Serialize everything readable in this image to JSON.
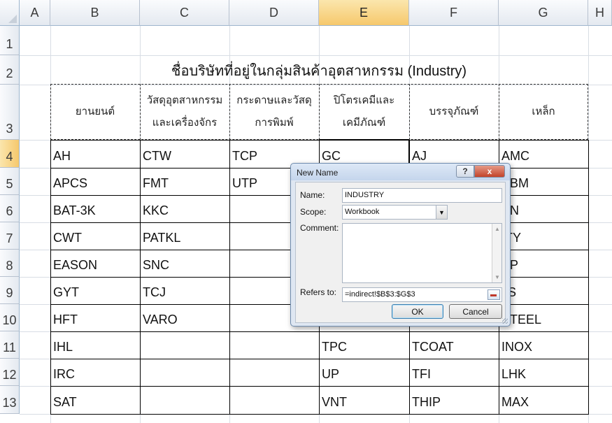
{
  "columns": [
    "A",
    "B",
    "C",
    "D",
    "E",
    "F",
    "G",
    "H"
  ],
  "rows": [
    "1",
    "2",
    "3",
    "4",
    "5",
    "6",
    "7",
    "8",
    "9",
    "10",
    "11",
    "12",
    "13"
  ],
  "title": "ชื่อบริษัทที่อยู่ในกลุ่มสินค้าอุตสาหกรรม (Industry)",
  "headers": [
    [
      "ยานยนต์"
    ],
    [
      "วัสดุอุตสาหกรรม",
      "และเครื่องจักร"
    ],
    [
      "กระดาษและวัสดุ",
      "การพิมพ์"
    ],
    [
      "ปิโตรเคมีและ",
      "เคมีภัณฑ์"
    ],
    [
      "บรรจุภัณฑ์"
    ],
    [
      "เหล็ก"
    ]
  ],
  "table": [
    [
      "AH",
      "CTW",
      "TCP",
      "GC",
      "AJ",
      "AMC"
    ],
    [
      "APCS",
      "FMT",
      "UTP",
      "",
      "",
      "SBM"
    ],
    [
      "BAT-3K",
      "KKC",
      "",
      "",
      "",
      "EN"
    ],
    [
      "CWT",
      "PATKL",
      "",
      "",
      "",
      "ITY"
    ],
    [
      "EASON",
      "SNC",
      "",
      "",
      "",
      "SP"
    ],
    [
      "GYT",
      "TCJ",
      "",
      "",
      "",
      "JS"
    ],
    [
      "HFT",
      "VARO",
      "",
      "",
      "",
      "STEEL"
    ],
    [
      "IHL",
      "",
      "",
      "TPC",
      "TCOAT",
      "INOX"
    ],
    [
      "IRC",
      "",
      "",
      "UP",
      "TFI",
      "LHK"
    ],
    [
      "SAT",
      "",
      "",
      "VNT",
      "THIP",
      "MAX"
    ]
  ],
  "dialog": {
    "title": "New Name",
    "help_label": "?",
    "close_label": "x",
    "name_label": "Name:",
    "name_value": "INDUSTRY",
    "scope_label": "Scope:",
    "scope_value": "Workbook",
    "comment_label": "Comment:",
    "comment_value": "",
    "refers_label": "Refers to:",
    "refers_value": "=indirect!$B$3:$G$3",
    "ok_label": "OK",
    "cancel_label": "Cancel"
  }
}
